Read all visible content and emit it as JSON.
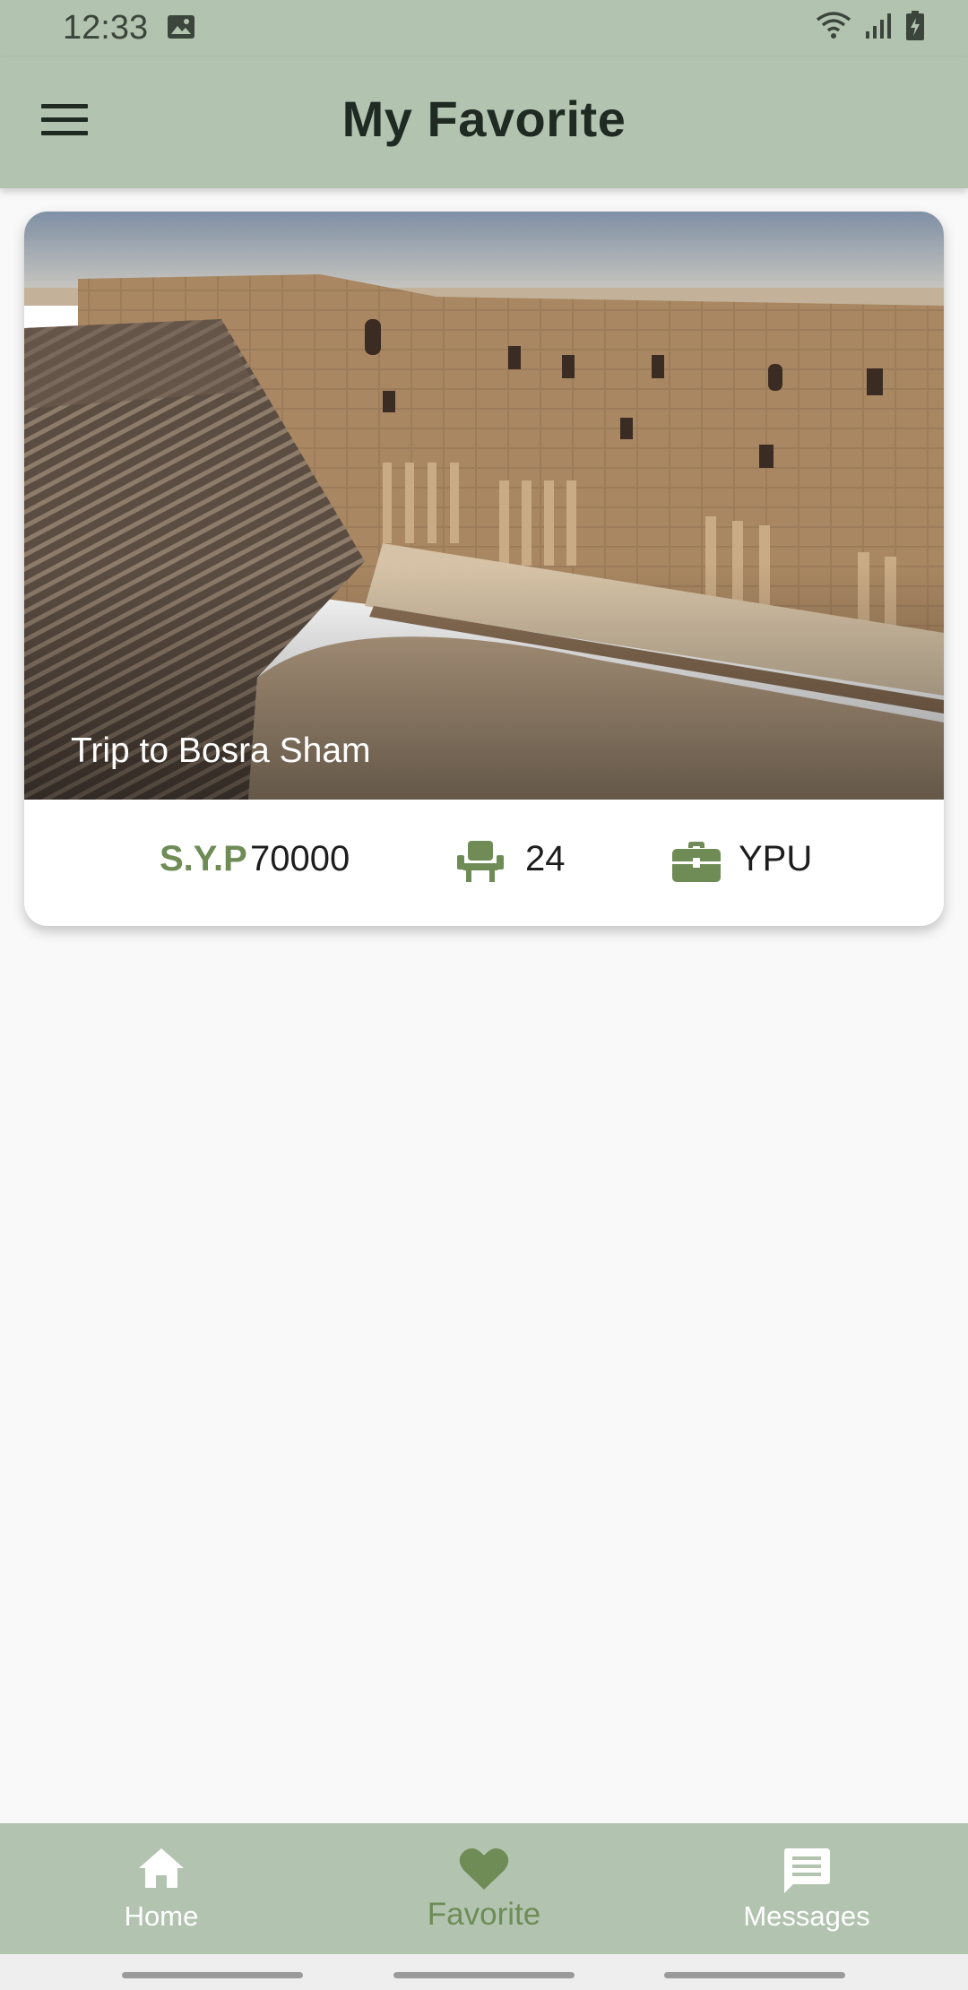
{
  "status_bar": {
    "time": "12:33"
  },
  "app_bar": {
    "title": "My Favorite"
  },
  "card": {
    "title": "Trip to Bosra Sham",
    "currency": "S.Y.P",
    "price": "70000",
    "seats": "24",
    "organizer": "YPU"
  },
  "bottom_nav": {
    "items": [
      {
        "label": "Home",
        "icon": "home-icon",
        "active": false
      },
      {
        "label": "Favorite",
        "icon": "heart-icon",
        "active": true
      },
      {
        "label": "Messages",
        "icon": "message-icon",
        "active": false
      }
    ]
  },
  "colors": {
    "app_bar": "#b2c4b0",
    "accent": "#6f8c57",
    "background": "#f9f9f9"
  }
}
